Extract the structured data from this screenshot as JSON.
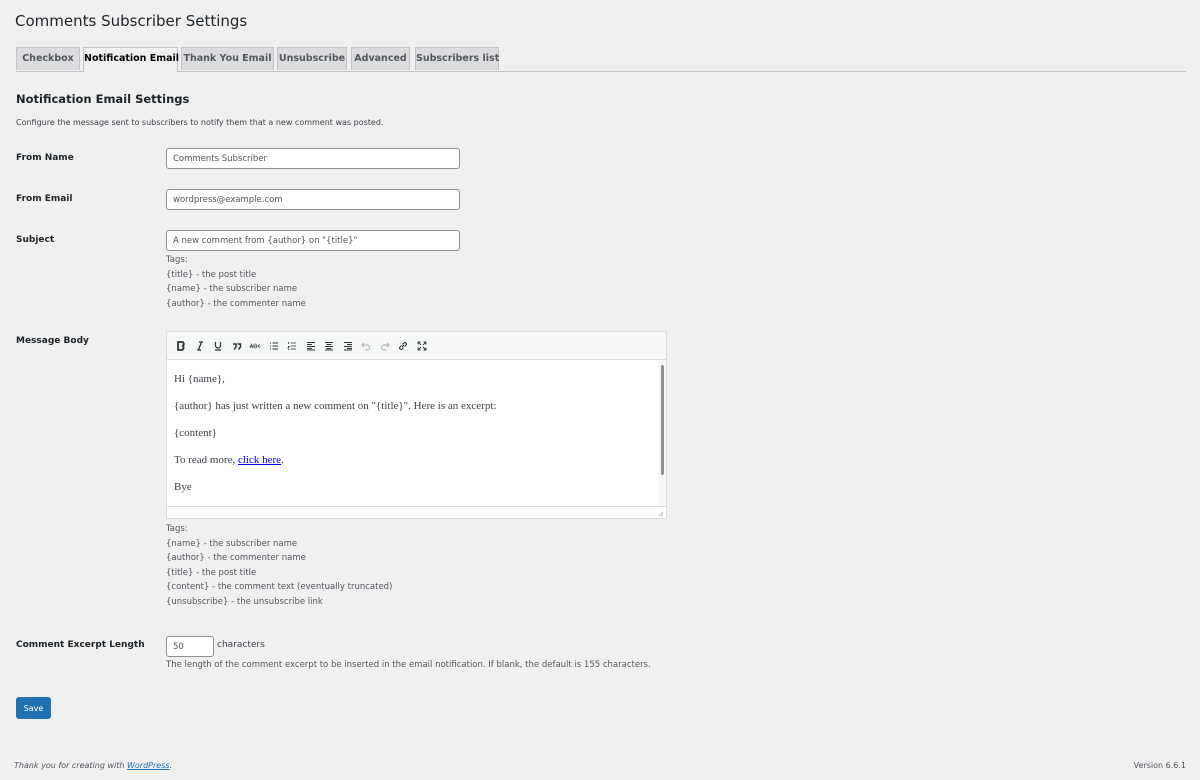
{
  "page": {
    "title": "Comments Subscriber Settings"
  },
  "tabs": [
    {
      "label": "Checkbox",
      "active": false
    },
    {
      "label": "Notification Email",
      "active": true
    },
    {
      "label": "Thank You Email",
      "active": false
    },
    {
      "label": "Unsubscribe",
      "active": false
    },
    {
      "label": "Advanced",
      "active": false
    },
    {
      "label": "Subscribers list",
      "active": false
    }
  ],
  "section": {
    "title": "Notification Email Settings",
    "description": "Configure the message sent to subscribers to notify them that a new comment was posted."
  },
  "fields": {
    "from_name": {
      "label": "From Name",
      "value": "Comments Subscriber"
    },
    "from_email": {
      "label": "From Email",
      "value": "wordpress@example.com"
    },
    "subject": {
      "label": "Subject",
      "value": "A new comment from {author} on \"{title}\"",
      "tags": [
        "Tags:",
        "{title} - the post title",
        "{name} - the subscriber name",
        "{author} - the commenter name"
      ]
    },
    "message_body": {
      "label": "Message Body",
      "toolbar": [
        "bold-icon",
        "italic-icon",
        "underline-icon",
        "blockquote-icon",
        "strikethrough-icon",
        "bulleted-list-icon",
        "numbered-list-icon",
        "align-left-icon",
        "align-center-icon",
        "align-right-icon",
        "undo-icon",
        "redo-icon",
        "link-icon",
        "fullscreen-icon"
      ],
      "content": {
        "greeting": "Hi {name},",
        "line1": "{author} has just written a new comment on \"{title}\". Here is an excerpt:",
        "line2": "{content}",
        "line3_prefix": "To read more, ",
        "line3_link": "click here",
        "line3_suffix": ".",
        "signoff": "Bye"
      },
      "tags": [
        "Tags:",
        "{name} - the subscriber name",
        "{author} - the commenter name",
        "{title} - the post title",
        "{content} - the comment text (eventually truncated)",
        "{unsubscribe} - the unsubscribe link"
      ]
    },
    "excerpt_length": {
      "label": "Comment Excerpt Length",
      "value": "50",
      "unit": "characters",
      "help": "The length of the comment excerpt to be inserted in the email notification. If blank, the default is 155 characters."
    }
  },
  "save_label": "Save",
  "footer": {
    "thanks_prefix": "Thank you for creating with ",
    "thanks_link": "WordPress",
    "thanks_suffix": ".",
    "version": "Version 6.6.1"
  },
  "colors": {
    "background": "#f0f0f1",
    "primary": "#2271b1",
    "text": "#1d2327"
  }
}
